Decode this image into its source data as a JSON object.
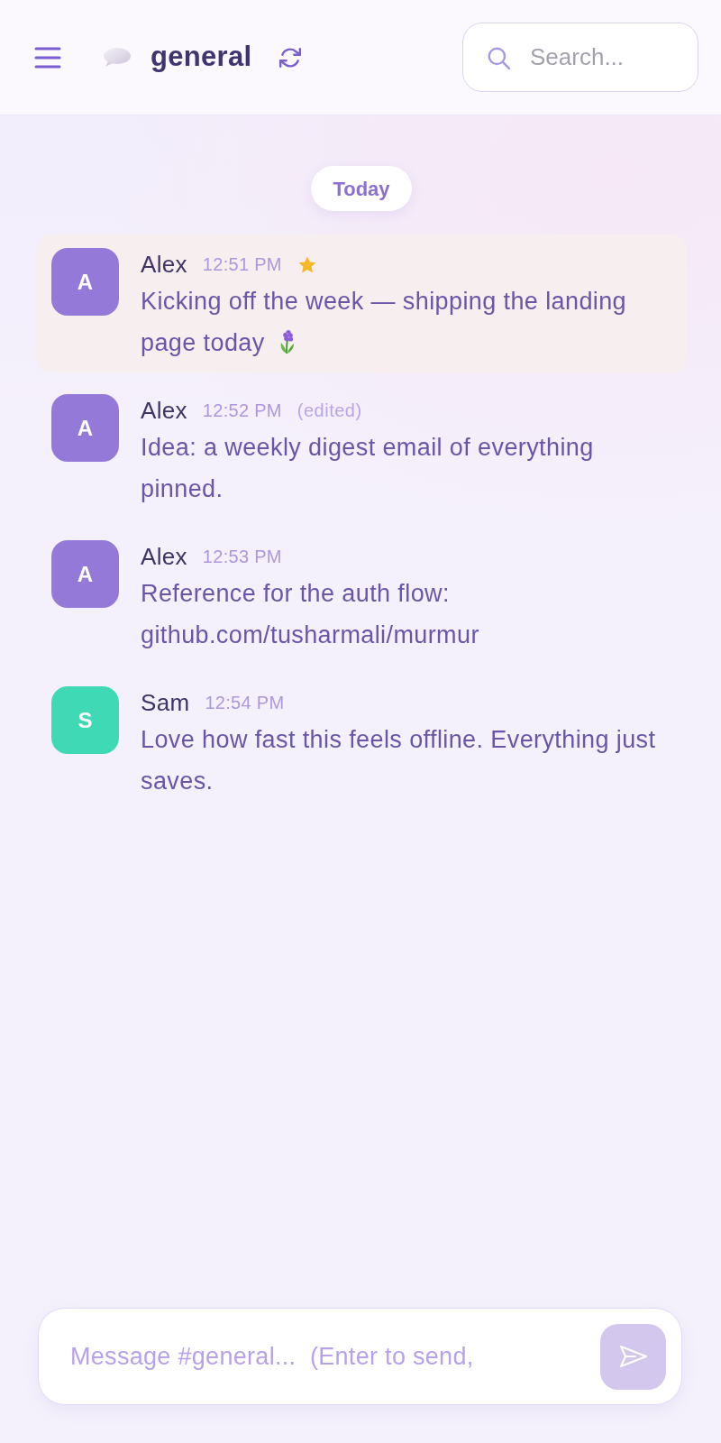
{
  "header": {
    "channel_name": "general",
    "search": {
      "placeholder": "Search..."
    }
  },
  "date_divider": "Today",
  "messages": [
    {
      "author": "Alex",
      "initial": "A",
      "color": "#9479d8",
      "time": "12:51 PM",
      "starred": true,
      "text": "Kicking off the week — shipping the landing page today",
      "emoji_attached": true
    },
    {
      "author": "Alex",
      "initial": "A",
      "color": "#9479d8",
      "time": "12:52 PM",
      "starred": false,
      "edited_label": "(edited)",
      "text": "Idea: a weekly digest email of everything pinned.",
      "emoji_attached": false
    },
    {
      "author": "Alex",
      "initial": "A",
      "color": "#9479d8",
      "time": "12:53 PM",
      "starred": false,
      "text": "Reference for the auth flow: github.com/tusharmali/murmur",
      "emoji_attached": false
    },
    {
      "author": "Sam",
      "initial": "S",
      "color": "#3fd9b5",
      "time": "12:54 PM",
      "starred": false,
      "text": "Love how fast this feels offline. Everything just saves.",
      "emoji_attached": false
    }
  ],
  "composer": {
    "placeholder": "Message #general...  (Enter to send,",
    "send_disabled": true
  }
}
